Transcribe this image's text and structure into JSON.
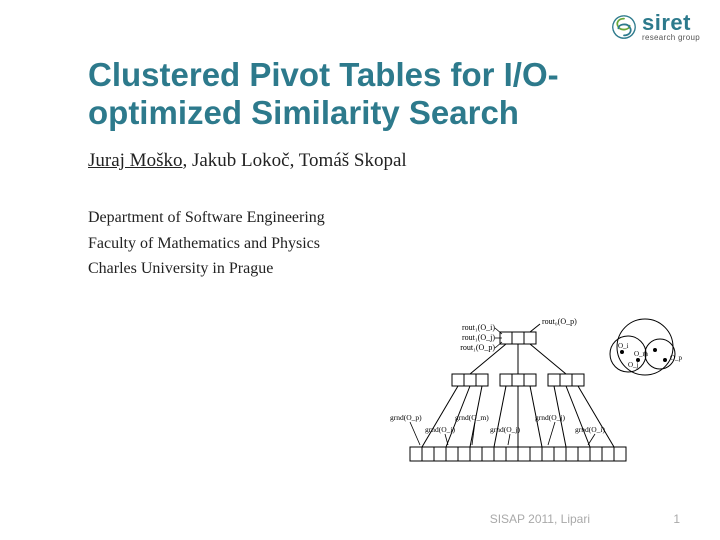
{
  "logo": {
    "name": "siret",
    "subtitle": "research group"
  },
  "title": "Clustered Pivot Tables for I/O-optimized Similarity Search",
  "authors": {
    "primary": "Juraj Moško",
    "rest": ", Jakub Lokoč, Tomáš Skopal"
  },
  "affiliation": {
    "line1": "Department of Software Engineering",
    "line2": "Faculty of Mathematics and Physics",
    "line3": "Charles University in Prague"
  },
  "diagram": {
    "labels": {
      "rout1oi": "rout₁(O_i)",
      "rout1oj": "rout₁(O_j)",
      "rout1op": "rout₁(O_p)",
      "rout0op": "rout₀(O_p)",
      "grndop": "grnd(O_p)",
      "grndoi": "grnd(O_i)",
      "grndom": "grnd(O_m)",
      "grndoj": "grnd(O_j)",
      "grndoj2": "grnd(O_j)",
      "grndoi2": "grnd(O_i)",
      "oi": "O_i",
      "oj": "O_j",
      "om": "O_m",
      "op": "O_p"
    }
  },
  "footer": {
    "venue": "SISAP 2011, Lipari",
    "page": "1"
  }
}
